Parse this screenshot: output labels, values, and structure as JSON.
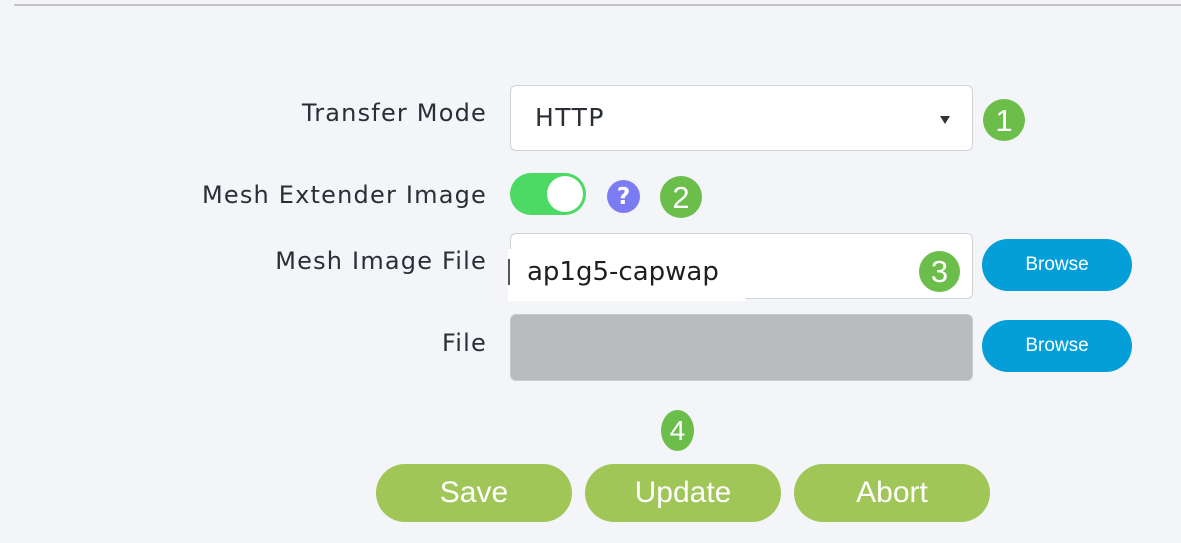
{
  "form": {
    "transfer_mode": {
      "label": "Transfer Mode",
      "selected": "HTTP",
      "step": "1"
    },
    "mesh_extender_image": {
      "label": "Mesh Extender Image",
      "enabled": true,
      "help_glyph": "?",
      "step": "2"
    },
    "mesh_image_file": {
      "label": "Mesh Image File",
      "value": "ap1g5-capwap",
      "browse_label": "Browse",
      "step": "3"
    },
    "file": {
      "label": "File",
      "value": "",
      "browse_label": "Browse"
    }
  },
  "actions": {
    "step": "4",
    "save_label": "Save",
    "update_label": "Update",
    "abort_label": "Abort"
  },
  "colors": {
    "toggle_on": "#4cd964",
    "step_badge": "#6cbe4b",
    "browse_button": "#049fd9",
    "action_button": "#a0c658",
    "help_icon": "#7b7cf2"
  }
}
